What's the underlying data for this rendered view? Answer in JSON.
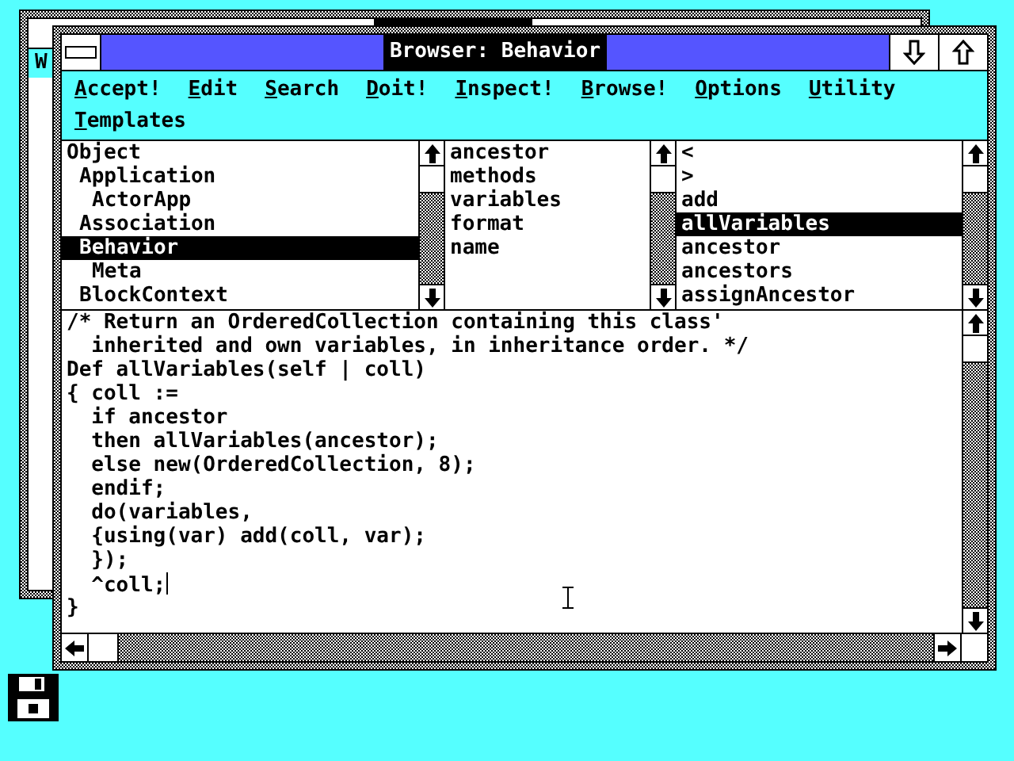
{
  "background_window": {
    "menu": [
      "W"
    ]
  },
  "window": {
    "title": "Browser: Behavior"
  },
  "menu": [
    {
      "label": "Accept!"
    },
    {
      "label": "Edit"
    },
    {
      "label": "Search"
    },
    {
      "label": "Doit!"
    },
    {
      "label": "Inspect!"
    },
    {
      "label": "Browse!"
    },
    {
      "label": "Options"
    },
    {
      "label": "Utility"
    },
    {
      "label": "Templates"
    }
  ],
  "classes": [
    {
      "label": "Object",
      "selected": false,
      "children": [
        {
          "label": "Application",
          "selected": false,
          "children": [
            {
              "label": "ActorApp",
              "selected": false
            }
          ]
        },
        {
          "label": "Association",
          "selected": false
        },
        {
          "label": "Behavior",
          "selected": true,
          "children": [
            {
              "label": "Meta",
              "selected": false
            }
          ]
        },
        {
          "label": "BlockContext",
          "selected": false
        }
      ]
    }
  ],
  "variables": [
    {
      "label": "ancestor",
      "selected": false
    },
    {
      "label": "methods",
      "selected": false
    },
    {
      "label": "variables",
      "selected": false
    },
    {
      "label": "format",
      "selected": false
    },
    {
      "label": "name",
      "selected": false
    }
  ],
  "methods": [
    {
      "label": "<",
      "selected": false
    },
    {
      "label": ">",
      "selected": false
    },
    {
      "label": "add",
      "selected": false
    },
    {
      "label": "allVariables",
      "selected": true
    },
    {
      "label": "ancestor",
      "selected": false
    },
    {
      "label": "ancestors",
      "selected": false
    },
    {
      "label": "assignAncestor",
      "selected": false
    }
  ],
  "editor": {
    "lines": [
      {
        "text": "/* Return an OrderedCollection containing this class'",
        "caret": false
      },
      {
        "text": "  inherited and own variables, in inheritance order. */",
        "caret": false
      },
      {
        "text": "Def allVariables(self | coll)",
        "caret": false
      },
      {
        "text": "{ coll :=",
        "caret": false
      },
      {
        "text": "  if ancestor",
        "caret": false
      },
      {
        "text": "  then allVariables(ancestor);",
        "caret": false
      },
      {
        "text": "  else new(OrderedCollection, 8);",
        "caret": false
      },
      {
        "text": "  endif;",
        "caret": false
      },
      {
        "text": "  do(variables,",
        "caret": false
      },
      {
        "text": "  {using(var) add(coll, var);",
        "caret": false
      },
      {
        "text": "  });",
        "caret": false
      },
      {
        "text": "  ^coll;",
        "caret": true
      },
      {
        "text": "}",
        "caret": false
      }
    ]
  }
}
